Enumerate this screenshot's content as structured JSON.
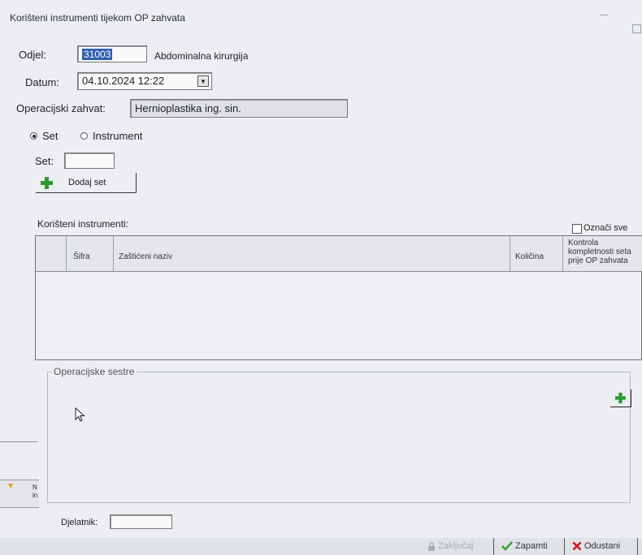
{
  "window": {
    "title": "Korišteni instrumenti tijekom OP zahvata"
  },
  "odjel": {
    "label": "Odjel:",
    "code": "31003",
    "name": "Abdominalna kirurgija"
  },
  "datum": {
    "label": "Datum:",
    "value": "04.10.2024 12:22",
    "dropdown_glyph": "▼"
  },
  "zahvat": {
    "label": "Operacijski zahvat:",
    "value": "Hernioplastika ing. sin."
  },
  "mode": {
    "options": [
      "Set",
      "Instrument"
    ],
    "selected": "Set"
  },
  "set": {
    "label": "Set:",
    "value": "",
    "add_button": "Dodaj set"
  },
  "instruments": {
    "title": "Korišteni instrumenti:",
    "select_all": "Označi sve",
    "columns": [
      "Šifra",
      "Zaštićeni naziv",
      "Količina",
      "Kontrola kompletnosti seta prije OP zahvata"
    ],
    "rows": []
  },
  "sestre": {
    "title": "Operacijske sestre"
  },
  "side_hint": {
    "line1": "N",
    "line2": "in"
  },
  "djelatnik": {
    "label": "Djelatnik:",
    "value": ""
  },
  "footer": {
    "lock": "Zaključaj",
    "save": "Zapamti",
    "cancel": "Odustani"
  },
  "colors": {
    "accent_green": "#2e9a2e",
    "cancel_red": "#d01919",
    "selection_blue": "#2f5fae"
  },
  "icons": [
    "plus-icon",
    "lock-icon",
    "check-icon",
    "x-icon",
    "mouse-cursor-icon",
    "chevron-down-icon",
    "warning-icon"
  ]
}
